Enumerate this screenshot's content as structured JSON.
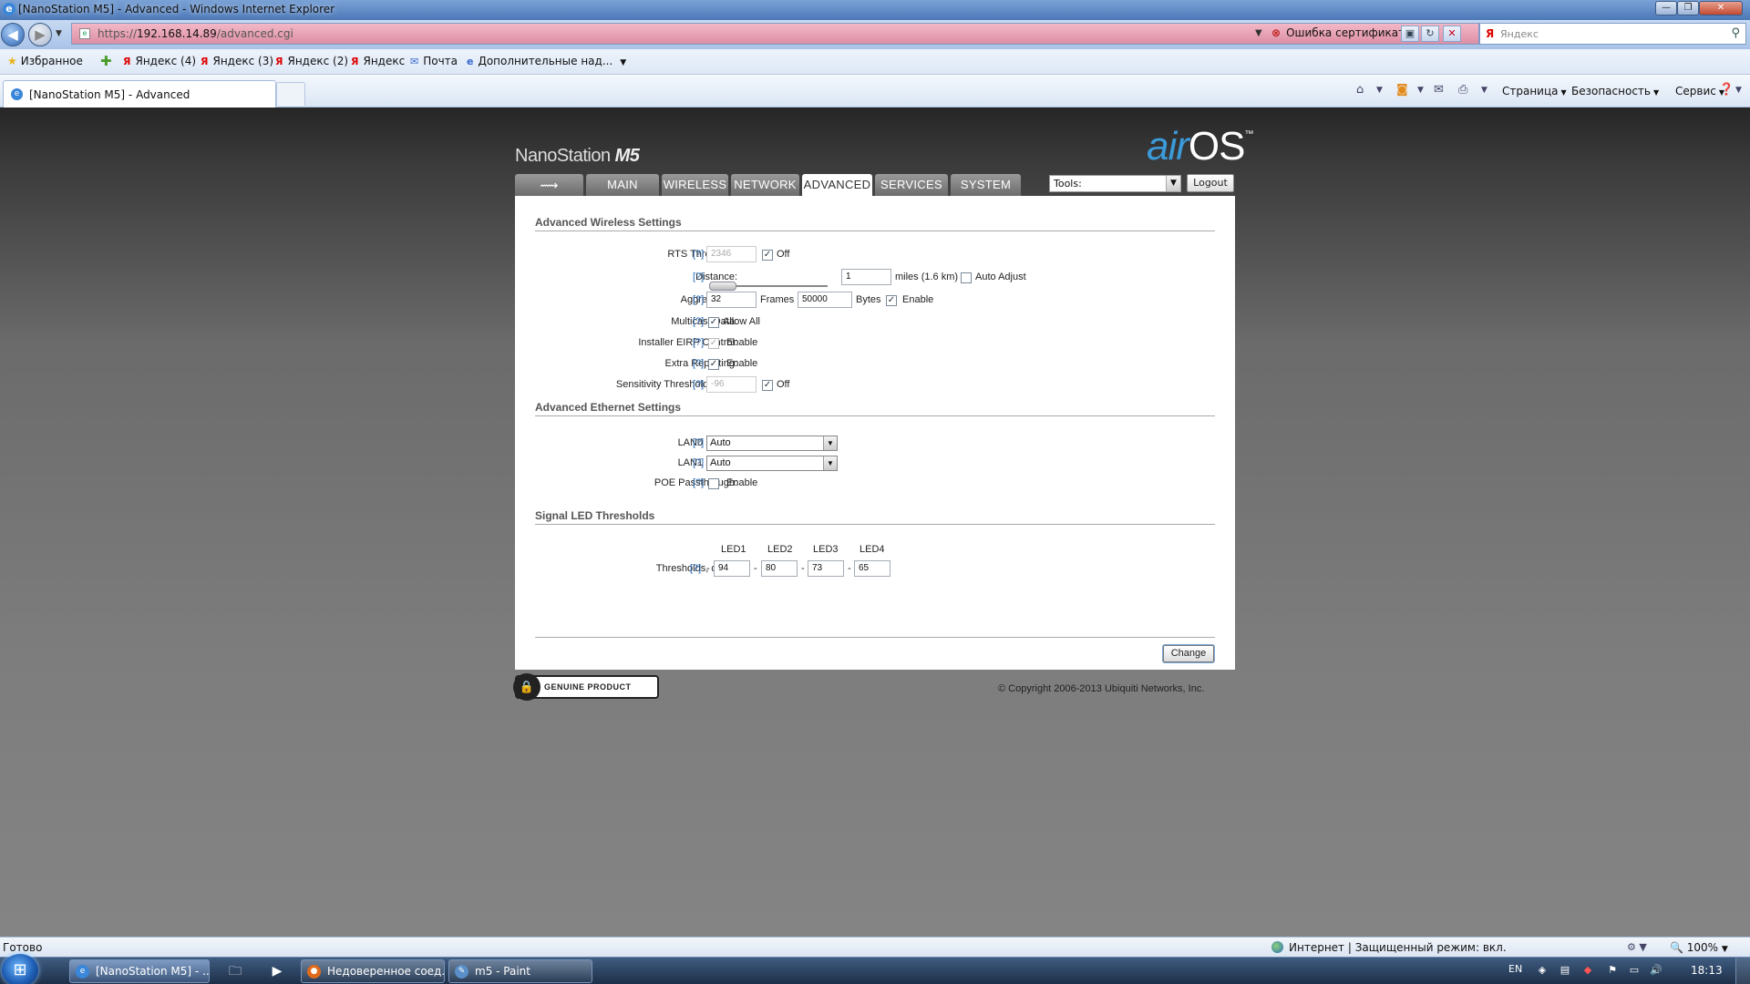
{
  "window": {
    "title": "[NanoStation M5] - Advanced - Windows Internet Explorer",
    "min": "—",
    "max": "❐",
    "close": "✕"
  },
  "address": {
    "url_prefix": "https://",
    "url_host": "192.168.14.89",
    "url_path": "/advanced.cgi",
    "cert_error": "Ошибка сертификата"
  },
  "search": {
    "placeholder": "Яндекс"
  },
  "favorites": {
    "favorites_label": "Избранное",
    "items": [
      "Яндекс (4)",
      "Яндекс (3)",
      "Яндекс (2)",
      "Яндекс",
      "Почта",
      "Дополнительные над..."
    ]
  },
  "tab": {
    "title": "[NanoStation M5] - Advanced"
  },
  "commands": {
    "page": "Страница",
    "safety": "Безопасность",
    "service": "Сервис"
  },
  "device": {
    "model": "NanoStation",
    "model_suffix": "M5",
    "os_air": "air",
    "os_os": "OS",
    "tm": "™"
  },
  "nav": {
    "tabs": [
      {
        "label": "MAIN"
      },
      {
        "label": "WIRELESS"
      },
      {
        "label": "NETWORK"
      },
      {
        "label": "ADVANCED"
      },
      {
        "label": "SERVICES"
      },
      {
        "label": "SYSTEM"
      }
    ],
    "active": "ADVANCED",
    "tools_label": "Tools:",
    "logout": "Logout"
  },
  "wireless": {
    "section_title": "Advanced Wireless Settings",
    "help": "[?]",
    "rts_label": "RTS Threshold:",
    "rts_value": "2346",
    "rts_off_checked": true,
    "off_label": "Off",
    "distance_label": "Distance:",
    "distance_value": "1",
    "distance_unit": "miles (1.6 km)",
    "distance_slider_fraction": 0.0,
    "auto_adjust_label": "Auto Adjust",
    "auto_adjust_checked": false,
    "aggregation_label": "Aggregation:",
    "aggregation_frames": "32",
    "frames_label": "Frames",
    "aggregation_bytes": "50000",
    "bytes_label": "Bytes",
    "enable_label": "Enable",
    "aggregation_enabled": true,
    "multicast_label": "Multicast Data:",
    "multicast_checked": true,
    "allow_all_label": "Allow All",
    "eirp_label": "Installer EIRP Control:",
    "eirp_checked": true,
    "extra_label": "Extra Reporting:",
    "extra_checked": true,
    "sensitivity_label": "Sensitivity Threshold, dBm:",
    "sensitivity_value": "-96",
    "sensitivity_off_checked": true
  },
  "ethernet": {
    "section_title": "Advanced Ethernet Settings",
    "lan0_label": "LAN0 Speed:",
    "lan0_value": "Auto",
    "lan1_label": "LAN1 Speed:",
    "lan1_value": "Auto",
    "poe_label": "POE Passthrough:",
    "poe_checked": false,
    "enable_label": "Enable"
  },
  "led": {
    "section_title": "Signal LED Thresholds",
    "headers": [
      "LED1",
      "LED2",
      "LED3",
      "LED4"
    ],
    "thresholds_label": "Thresholds, dBm:",
    "values": [
      "94",
      "80",
      "73",
      "65"
    ],
    "dash": "-"
  },
  "change_button": "Change",
  "genuine": "GENUINE PRODUCT",
  "copyright": "© Copyright 2006-2013 Ubiquiti Networks, Inc.",
  "status": {
    "left": "Готово",
    "zone": "Интернет | Защищенный режим: вкл.",
    "zoom": "100%"
  },
  "taskbar": {
    "items": [
      "[NanoStation M5] - ...",
      "Недоверенное соед...",
      "m5 - Paint"
    ],
    "lang": "EN",
    "time": "18:13"
  }
}
